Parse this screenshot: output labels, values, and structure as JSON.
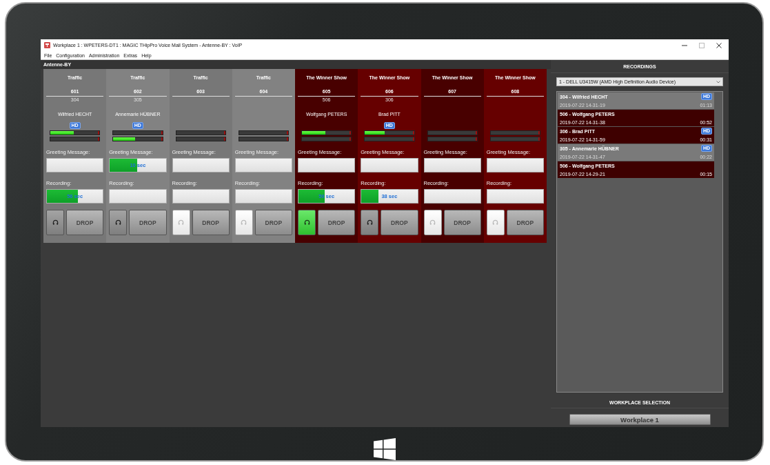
{
  "window": {
    "title": "Workplace 1 : WPETERS-DT1 : MAGIC THipPro Voice Mail System - Antenne-BY : VoIP"
  },
  "menu": [
    "File",
    "Configuration",
    "Administration",
    "Extras",
    "Help"
  ],
  "station": "Antenne-BY",
  "channels": [
    {
      "show": "Traffic",
      "number": "601",
      "extension": "304",
      "caller": "Wilfried HECHT",
      "hd": "HD",
      "color": "#777777",
      "meters": [
        {
          "level": 0.48
        },
        {
          "level": 0
        }
      ],
      "greeting": {
        "label": "Greeting Message:"
      },
      "recording": {
        "label": "Recording:",
        "level": 0.55,
        "value": "56 sec"
      },
      "listening": false,
      "disabled": false,
      "drop": "DROP"
    },
    {
      "show": "Traffic",
      "number": "602",
      "extension": "305",
      "caller": "Annemarie HÜBNER",
      "hd": "HD",
      "color": "#828282",
      "meters": [
        {
          "level": 0
        },
        {
          "level": 0.45
        }
      ],
      "greeting": {
        "label": "Greeting Message:",
        "level": 0.49,
        "value": "10 sec"
      },
      "recording": {
        "label": "Recording:"
      },
      "listening": false,
      "disabled": false,
      "drop": "DROP"
    },
    {
      "show": "Traffic",
      "number": "603",
      "color": "#777777",
      "meters": [
        {
          "level": 0
        },
        {
          "level": 0
        }
      ],
      "greeting": {
        "label": "Greeting Message:"
      },
      "recording": {
        "label": "Recording:"
      },
      "listening": false,
      "disabled": true,
      "drop": "DROP"
    },
    {
      "show": "Traffic",
      "number": "604",
      "color": "#828282",
      "meters": [
        {
          "level": 0
        },
        {
          "level": 0
        }
      ],
      "greeting": {
        "label": "Greeting Message:"
      },
      "recording": {
        "label": "Recording:"
      },
      "listening": false,
      "disabled": true,
      "drop": "DROP"
    },
    {
      "show": "The Winner Show",
      "number": "605",
      "extension": "506",
      "caller": "Wolfgang PETERS",
      "color": "#480000",
      "meters": [
        {
          "level": 0.48
        },
        {
          "level": 0
        }
      ],
      "greeting": {
        "label": "Greeting Message:"
      },
      "recording": {
        "label": "Recording:",
        "level": 0.47,
        "value": "59 sec"
      },
      "listening": true,
      "disabled": false,
      "drop": "DROP"
    },
    {
      "show": "The Winner Show",
      "number": "606",
      "extension": "306",
      "caller": "Brad PITT",
      "hd": "HD",
      "color": "#660000",
      "meters": [
        {
          "level": 0.4
        },
        {
          "level": 0
        }
      ],
      "greeting": {
        "label": "Greeting Message:"
      },
      "recording": {
        "label": "Recording:",
        "level": 0.3,
        "value": "38 sec"
      },
      "listening": false,
      "disabled": false,
      "drop": "DROP"
    },
    {
      "show": "The Winner Show",
      "number": "607",
      "color": "#480000",
      "meters": [
        {
          "level": 0
        },
        {
          "level": 0
        }
      ],
      "greeting": {
        "label": "Greeting Message:"
      },
      "recording": {
        "label": "Recording:"
      },
      "listening": false,
      "disabled": true,
      "drop": "DROP"
    },
    {
      "show": "The Winner Show",
      "number": "608",
      "color": "#660000",
      "meters": [
        {
          "level": 0
        },
        {
          "level": 0
        }
      ],
      "greeting": {
        "label": "Greeting Message:"
      },
      "recording": {
        "label": "Recording:"
      },
      "listening": false,
      "disabled": true,
      "drop": "DROP"
    }
  ],
  "recordings": {
    "title": "RECORDINGS",
    "device": "1 - DELL U3415W (AMD High Definition Audio Device)",
    "items": [
      {
        "caller": "304 - Wilfried HECHT",
        "time": "2019-07-22 14-31-19",
        "duration": "01:13",
        "hd": "HD",
        "color": "#7a7a7a"
      },
      {
        "caller": "506 - Wolfgang PETERS",
        "time": "2019-07-22 14-31-38",
        "duration": "00:52",
        "color": "#3e0000"
      },
      {
        "caller": "306 - Brad PITT",
        "time": "2019-07-22 14-31-59",
        "duration": "00:31",
        "hd": "HD",
        "color": "#3e0000"
      },
      {
        "caller": "305 - Annemarie HÜBNER",
        "time": "2019-07-22 14-31-47",
        "duration": "00:22",
        "hd": "HD",
        "color": "#7a7a7a"
      },
      {
        "caller": "506 - Wolfgang PETERS",
        "time": "2019-07-22 14-29-21",
        "duration": "00:15",
        "color": "#3e0000"
      }
    ]
  },
  "workplace": {
    "title": "WORKPLACE SELECTION",
    "button": "Workplace 1"
  }
}
